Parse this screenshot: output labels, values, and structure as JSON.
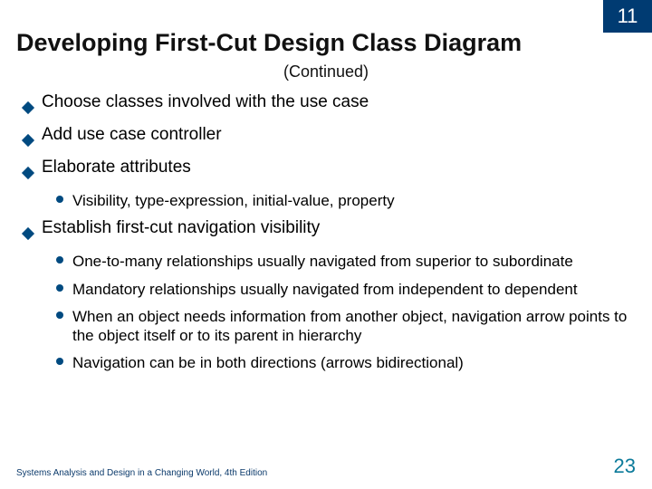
{
  "chapter_number": "11",
  "title": "Developing First-Cut Design Class Diagram",
  "subtitle": "(Continued)",
  "bullets": {
    "b0": "Choose classes involved with the use case",
    "b1": "Add use case controller",
    "b2": "Elaborate attributes",
    "b2_sub": {
      "s0": "Visibility, type-expression, initial-value, property"
    },
    "b3": "Establish first-cut navigation visibility",
    "b3_sub": {
      "s0": "One-to-many relationships usually navigated from superior to subordinate",
      "s1": "Mandatory relationships usually navigated from independent to dependent",
      "s2": "When an object needs information from another object, navigation arrow points to the object itself or to its parent in hierarchy",
      "s3": "Navigation can be in both directions (arrows bidirectional)"
    }
  },
  "footer": {
    "left": "Systems Analysis and Design in a Changing World, 4th Edition",
    "page": "23"
  }
}
